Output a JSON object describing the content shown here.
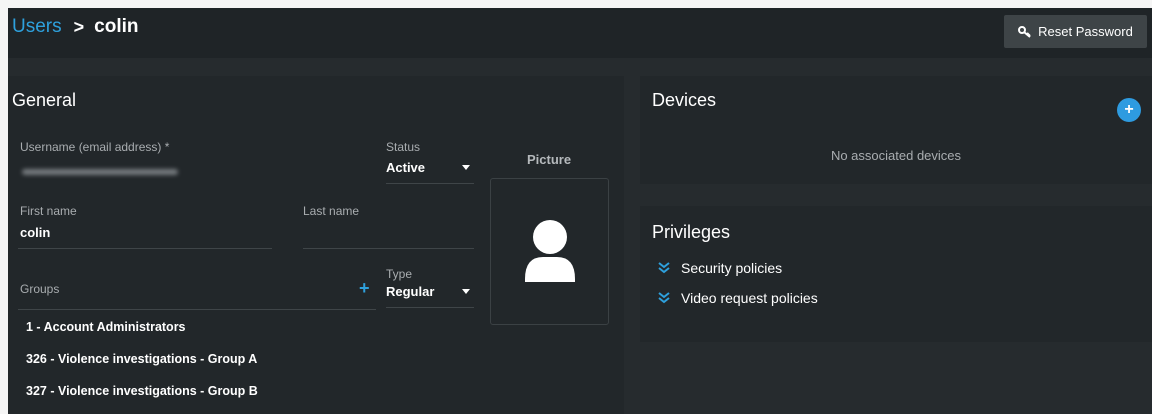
{
  "header": {
    "breadcrumb_parent": "Users",
    "breadcrumb_separator": ">",
    "breadcrumb_current": "colin",
    "reset_password_label": "Reset Password",
    "reset_icon": "key-icon"
  },
  "general": {
    "title": "General",
    "username_label": "Username (email address) *",
    "username_value": "cgreenlaw@genetec.com",
    "status_label": "Status",
    "status_value": "Active",
    "picture_label": "Picture",
    "first_name_label": "First name",
    "first_name_value": "colin",
    "last_name_label": "Last name",
    "last_name_value": "",
    "groups_label": "Groups",
    "type_label": "Type",
    "type_value": "Regular",
    "groups": [
      "1 - Account Administrators",
      "326 - Violence investigations - Group A",
      "327 - Violence investigations - Group B"
    ]
  },
  "devices": {
    "title": "Devices",
    "empty_text": "No associated devices",
    "add_icon": "plus-circle-icon"
  },
  "privileges": {
    "title": "Privileges",
    "policies": [
      "Security policies",
      "Video request policies"
    ]
  },
  "colors": {
    "accent": "#2ea0dc",
    "background": "#262b2e",
    "panel": "#22272a"
  }
}
